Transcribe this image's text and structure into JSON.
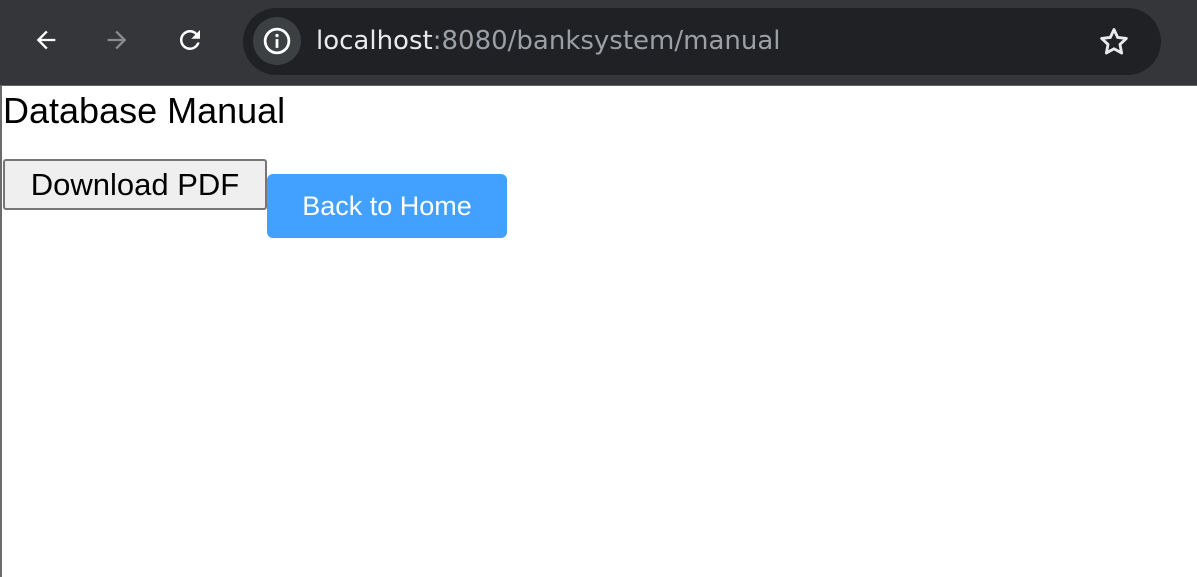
{
  "browser": {
    "url_host": "localhost",
    "url_path": ":8080/banksystem/manual",
    "icons": {
      "back": "back-arrow-icon",
      "forward": "forward-arrow-icon",
      "reload": "reload-icon",
      "site_info": "info-icon",
      "bookmark": "star-icon"
    },
    "colors": {
      "toolbar": "#35363a",
      "omnibox": "#202124"
    }
  },
  "page": {
    "title": "Database Manual",
    "download_button_label": "Download PDF",
    "home_button_label": "Back to Home",
    "colors": {
      "home_button": "#42a1ff",
      "home_button_text": "#ffffff"
    }
  }
}
